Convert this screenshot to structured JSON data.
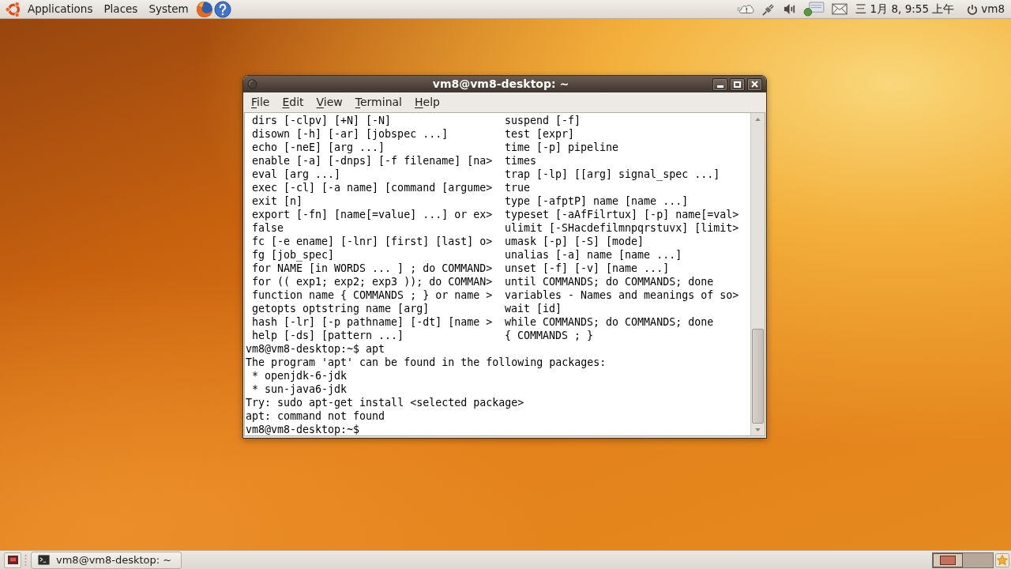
{
  "top_panel": {
    "menus": [
      "Applications",
      "Places",
      "System"
    ],
    "clock": "三 1月 8, 9:55 上午",
    "user": "vm8"
  },
  "terminal_window": {
    "title": "vm8@vm8-desktop: ~",
    "menu": [
      "File",
      "Edit",
      "View",
      "Terminal",
      "Help"
    ],
    "help_rows": [
      {
        "column_1": "dirs [-clpv] [+N] [-N]",
        "column_2": "suspend [-f]"
      },
      {
        "column_1": "disown [-h] [-ar] [jobspec ...]",
        "column_2": "test [expr]"
      },
      {
        "column_1": "echo [-neE] [arg ...]",
        "column_2": "time [-p] pipeline"
      },
      {
        "column_1": "enable [-a] [-dnps] [-f filename] [na>",
        "column_2": "times"
      },
      {
        "column_1": "eval [arg ...]",
        "column_2": "trap [-lp] [[arg] signal_spec ...]"
      },
      {
        "column_1": "exec [-cl] [-a name] [command [argume>",
        "column_2": "true"
      },
      {
        "column_1": "exit [n]",
        "column_2": "type [-afptP] name [name ...]"
      },
      {
        "column_1": "export [-fn] [name[=value] ...] or ex>",
        "column_2": "typeset [-aAfFilrtux] [-p] name[=val>"
      },
      {
        "column_1": "false",
        "column_2": "ulimit [-SHacdefilmnpqrstuvx] [limit>"
      },
      {
        "column_1": "fc [-e ename] [-lnr] [first] [last] o>",
        "column_2": "umask [-p] [-S] [mode]"
      },
      {
        "column_1": "fg [job_spec]",
        "column_2": "unalias [-a] name [name ...]"
      },
      {
        "column_1": "for NAME [in WORDS ... ] ; do COMMAND>",
        "column_2": "unset [-f] [-v] [name ...]"
      },
      {
        "column_1": "for (( exp1; exp2; exp3 )); do COMMAN>",
        "column_2": "until COMMANDS; do COMMANDS; done"
      },
      {
        "column_1": "function name { COMMANDS ; } or name >",
        "column_2": "variables - Names and meanings of so>"
      },
      {
        "column_1": "getopts optstring name [arg]",
        "column_2": "wait [id]"
      },
      {
        "column_1": "hash [-lr] [-p pathname] [-dt] [name >",
        "column_2": "while COMMANDS; do COMMANDS; done"
      },
      {
        "column_1": "help [-ds] [pattern ...]",
        "column_2": "{ COMMANDS ; }"
      }
    ],
    "output_lines": [
      "vm8@vm8-desktop:~$ apt",
      "The program 'apt' can be found in the following packages:",
      " * openjdk-6-jdk",
      " * sun-java6-jdk",
      "Try: sudo apt-get install <selected package>",
      "apt: command not found",
      "vm8@vm8-desktop:~$"
    ]
  },
  "bottom_panel": {
    "tasks": [
      {
        "label": "vm8@vm8-desktop: ~",
        "selected": false
      }
    ],
    "workspaces": [
      {
        "selected": true,
        "has_window": true
      },
      {
        "selected": false,
        "has_window": false
      }
    ]
  }
}
